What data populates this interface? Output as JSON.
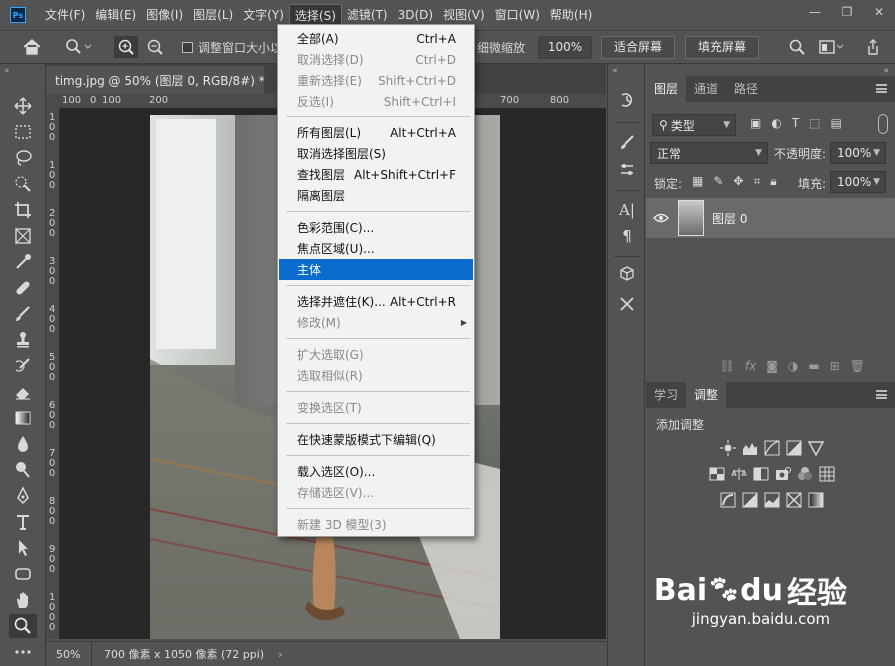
{
  "menubar": {
    "logo": "Ps",
    "items": [
      "文件(F)",
      "编辑(E)",
      "图像(I)",
      "图层(L)",
      "文字(Y)",
      "选择(S)",
      "滤镜(T)",
      "3D(D)",
      "视图(V)",
      "窗口(W)",
      "帮助(H)"
    ],
    "active_index": 5,
    "window_controls": [
      "—",
      "❐",
      "✕"
    ]
  },
  "options": {
    "resize_window_label": "调整窗口大小以",
    "fine_zoom_label": "细微缩放",
    "zoom_value": "100%",
    "fit_screen": "适合屏幕",
    "fill_screen": "填充屏幕"
  },
  "document": {
    "tab_title": "timg.jpg @ 50% (图层 0, RGB/8#) *",
    "tab_close": "×",
    "ruler_h_ticks": [
      "100",
      "0",
      "100",
      "200",
      "700",
      "800"
    ],
    "ruler_v_ticks": [
      "1 0 0",
      "1 0 0",
      "2 0 0",
      "3 0 0",
      "4 0 0",
      "5 0 0",
      "6 0 0",
      "7 0 0",
      "8 0 0",
      "9 0 0",
      "1 0 0 0"
    ],
    "zoom": "50%",
    "doc_size": "700 像素 x 1050 像素 (72 ppi)",
    "status_arrow": "›"
  },
  "select_menu": {
    "items": [
      {
        "label": "全部(A)",
        "shortcut": "Ctrl+A",
        "disabled": false
      },
      {
        "label": "取消选择(D)",
        "shortcut": "Ctrl+D",
        "disabled": true
      },
      {
        "label": "重新选择(E)",
        "shortcut": "Shift+Ctrl+D",
        "disabled": true
      },
      {
        "label": "反选(I)",
        "shortcut": "Shift+Ctrl+I",
        "disabled": true
      },
      {
        "label": "所有图层(L)",
        "shortcut": "Alt+Ctrl+A",
        "disabled": false
      },
      {
        "label": "取消选择图层(S)",
        "shortcut": "",
        "disabled": false
      },
      {
        "label": "查找图层",
        "shortcut": "Alt+Shift+Ctrl+F",
        "disabled": false
      },
      {
        "label": "隔离图层",
        "shortcut": "",
        "disabled": false
      },
      {
        "label": "色彩范围(C)...",
        "shortcut": "",
        "disabled": false
      },
      {
        "label": "焦点区域(U)...",
        "shortcut": "",
        "disabled": false
      },
      {
        "label": "主体",
        "shortcut": "",
        "disabled": false,
        "highlighted": true
      },
      {
        "label": "选择并遮住(K)...",
        "shortcut": "Alt+Ctrl+R",
        "disabled": false
      },
      {
        "label": "修改(M)",
        "shortcut": "",
        "disabled": true,
        "submenu": true
      },
      {
        "label": "扩大选取(G)",
        "shortcut": "",
        "disabled": true
      },
      {
        "label": "选取相似(R)",
        "shortcut": "",
        "disabled": true
      },
      {
        "label": "变换选区(T)",
        "shortcut": "",
        "disabled": true
      },
      {
        "label": "在快速蒙版模式下编辑(Q)",
        "shortcut": "",
        "disabled": false
      },
      {
        "label": "载入选区(O)...",
        "shortcut": "",
        "disabled": false
      },
      {
        "label": "存储选区(V)...",
        "shortcut": "",
        "disabled": true
      },
      {
        "label": "新建 3D 模型(3)",
        "shortcut": "",
        "disabled": true
      }
    ],
    "submenu_arrow": "▶"
  },
  "layers_panel": {
    "tabs": [
      "图层",
      "通道",
      "路径"
    ],
    "filter_kind": "类型",
    "blend_mode": "正常",
    "opacity_label": "不透明度:",
    "opacity_value": "100%",
    "lock_label": "锁定:",
    "fill_label": "填充:",
    "fill_value": "100%",
    "layer_name": "图层 0",
    "footer_fx": "fx"
  },
  "adjust_panel": {
    "tabs": [
      "学习",
      "调整"
    ],
    "title": "添加调整"
  },
  "watermark": {
    "brand": "Bai",
    "brand2": "du",
    "brand_cn": "经验",
    "url": "jingyan.baidu.com"
  },
  "colors": {
    "accent_highlight": "#0a6ccf",
    "ps_logo": "#31a8ff"
  }
}
